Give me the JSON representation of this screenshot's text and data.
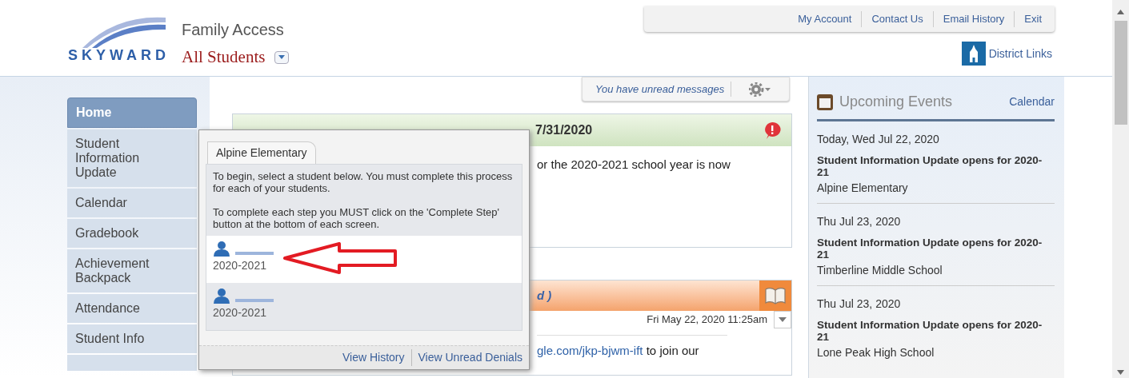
{
  "header": {
    "logo_text": "SKYWARD",
    "title": "Family Access",
    "student_picker": "All Students",
    "district_links": "District Links"
  },
  "top_links": [
    "My Account",
    "Contact Us",
    "Email History",
    "Exit"
  ],
  "nav": [
    {
      "label": "Home",
      "selected": true
    },
    {
      "label": "Student Information Update",
      "selected": false
    },
    {
      "label": "Calendar",
      "selected": false
    },
    {
      "label": "Gradebook",
      "selected": false
    },
    {
      "label": "Achievement Backpack",
      "selected": false
    },
    {
      "label": "Attendance",
      "selected": false
    },
    {
      "label": "Student Info",
      "selected": false
    }
  ],
  "messages_bar": {
    "text": "You have unread messages"
  },
  "cards": [
    {
      "kind": "alert",
      "title": "7/31/2020",
      "body": "or the 2020-2021 school year is now"
    },
    {
      "kind": "message",
      "title": "d )",
      "date": "Fri May 22, 2020 11:25am",
      "link": "gle.com/jkp-bjwm-ift",
      "body": " to join our"
    }
  ],
  "popup": {
    "tab": "Alpine Elementary",
    "intro": "To begin, select a student below. You must complete this process for each of your students.",
    "instructions": "To complete each step you MUST click on the 'Complete Step' button at the bottom of each screen.",
    "students": [
      {
        "year": "2020-2021",
        "selected": true
      },
      {
        "year": "2020-2021",
        "selected": false
      }
    ],
    "footer_links": [
      "View History",
      "View Unread Denials"
    ]
  },
  "events": {
    "title": "Upcoming Events",
    "link": "Calendar",
    "items": [
      {
        "date": "Today, Wed Jul 22, 2020",
        "title": "Student Information Update opens for 2020-21",
        "school": "Alpine Elementary"
      },
      {
        "date": "Thu Jul 23, 2020",
        "title": "Student Information Update opens for 2020-21",
        "school": "Timberline Middle School"
      },
      {
        "date": "Thu Jul 23, 2020",
        "title": "Student Information Update opens for 2020-21",
        "school": "Lone Peak High School"
      }
    ]
  }
}
